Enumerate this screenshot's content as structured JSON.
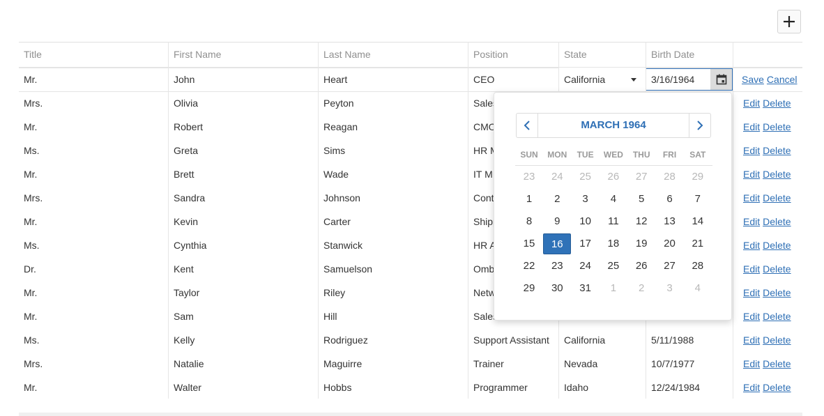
{
  "columns": [
    "Title",
    "First Name",
    "Last Name",
    "Position",
    "State",
    "Birth Date"
  ],
  "edit_row": {
    "title": "Mr.",
    "first_name": "John",
    "last_name": "Heart",
    "position": "CEO",
    "state": "California",
    "birth_date": "3/16/1964",
    "save_label": "Save",
    "cancel_label": "Cancel"
  },
  "rows": [
    {
      "title": "Mrs.",
      "first": "Olivia",
      "last": "Peyton",
      "position": "Sales",
      "state": "",
      "date": ""
    },
    {
      "title": "Mr.",
      "first": "Robert",
      "last": "Reagan",
      "position": "CMO",
      "state": "",
      "date": ""
    },
    {
      "title": "Ms.",
      "first": "Greta",
      "last": "Sims",
      "position": "HR M",
      "state": "",
      "date": ""
    },
    {
      "title": "Mr.",
      "first": "Brett",
      "last": "Wade",
      "position": "IT M",
      "state": "",
      "date": ""
    },
    {
      "title": "Mrs.",
      "first": "Sandra",
      "last": "Johnson",
      "position": "Cont",
      "state": "",
      "date": ""
    },
    {
      "title": "Mr.",
      "first": "Kevin",
      "last": "Carter",
      "position": "Shipp",
      "state": "",
      "date": ""
    },
    {
      "title": "Ms.",
      "first": "Cynthia",
      "last": "Stanwick",
      "position": "HR A",
      "state": "",
      "date": ""
    },
    {
      "title": "Dr.",
      "first": "Kent",
      "last": "Samuelson",
      "position": "Omb",
      "state": "",
      "date": ""
    },
    {
      "title": "Mr.",
      "first": "Taylor",
      "last": "Riley",
      "position": "Netw",
      "state": "",
      "date": ""
    },
    {
      "title": "Mr.",
      "first": "Sam",
      "last": "Hill",
      "position": "Sales",
      "state": "",
      "date": ""
    },
    {
      "title": "Ms.",
      "first": "Kelly",
      "last": "Rodriguez",
      "position": "Support Assistant",
      "state": "California",
      "date": "5/11/1988"
    },
    {
      "title": "Mrs.",
      "first": "Natalie",
      "last": "Maguirre",
      "position": "Trainer",
      "state": "Nevada",
      "date": "10/7/1977"
    },
    {
      "title": "Mr.",
      "first": "Walter",
      "last": "Hobbs",
      "position": "Programmer",
      "state": "Idaho",
      "date": "12/24/1984"
    }
  ],
  "row_actions": {
    "edit_label": "Edit",
    "delete_label": "Delete"
  },
  "calendar": {
    "title": "MARCH 1964",
    "weekdays": [
      "SUN",
      "MON",
      "TUE",
      "WED",
      "THU",
      "FRI",
      "SAT"
    ],
    "weeks": [
      [
        {
          "d": "23",
          "o": true
        },
        {
          "d": "24",
          "o": true
        },
        {
          "d": "25",
          "o": true
        },
        {
          "d": "26",
          "o": true
        },
        {
          "d": "27",
          "o": true
        },
        {
          "d": "28",
          "o": true
        },
        {
          "d": "29",
          "o": true
        }
      ],
      [
        {
          "d": "1"
        },
        {
          "d": "2"
        },
        {
          "d": "3"
        },
        {
          "d": "4"
        },
        {
          "d": "5"
        },
        {
          "d": "6"
        },
        {
          "d": "7"
        }
      ],
      [
        {
          "d": "8"
        },
        {
          "d": "9"
        },
        {
          "d": "10"
        },
        {
          "d": "11"
        },
        {
          "d": "12"
        },
        {
          "d": "13"
        },
        {
          "d": "14"
        }
      ],
      [
        {
          "d": "15"
        },
        {
          "d": "16",
          "s": true
        },
        {
          "d": "17"
        },
        {
          "d": "18"
        },
        {
          "d": "19"
        },
        {
          "d": "20"
        },
        {
          "d": "21"
        }
      ],
      [
        {
          "d": "22"
        },
        {
          "d": "23"
        },
        {
          "d": "24"
        },
        {
          "d": "25"
        },
        {
          "d": "26"
        },
        {
          "d": "27"
        },
        {
          "d": "28"
        }
      ],
      [
        {
          "d": "29"
        },
        {
          "d": "30"
        },
        {
          "d": "31"
        },
        {
          "d": "1",
          "o": true
        },
        {
          "d": "2",
          "o": true
        },
        {
          "d": "3",
          "o": true
        },
        {
          "d": "4",
          "o": true
        }
      ]
    ]
  },
  "colors": {
    "accent": "#2e6fb5",
    "selected_day": "#2f72b8"
  }
}
